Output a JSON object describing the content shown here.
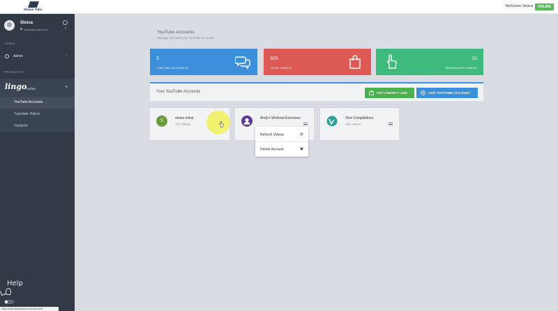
{
  "topbar": {
    "logo_text": "Shawn Tube",
    "welcome": "Welcome,Stoica",
    "status": "ONLINE"
  },
  "sidebar": {
    "profile": {
      "name": "Stoica",
      "email": "stoica@codeone.ro"
    },
    "section_admin": "ADMIN",
    "admin_item": "Admin",
    "section_products": "PRODUCTS",
    "product": {
      "logo": "lingo",
      "suffix": "Tracker"
    },
    "subnav": [
      {
        "label": "YouTube Accounts",
        "active": true
      },
      {
        "label": "Translate Videos",
        "active": false
      },
      {
        "label": "Vanitylist",
        "active": false
      }
    ],
    "help": "Help",
    "status_url": "https://www.lingotracker.com/account#"
  },
  "main": {
    "title": "YouTube Accounts",
    "subtitle": "Manage and add your YouTube accounts",
    "stats": [
      {
        "value": "3",
        "label": "YOUTUBE ACCOUNTS",
        "color": "#3b8fdb",
        "icon": "chat-bubbles-icon"
      },
      {
        "value": "305",
        "label": "TOTAL VIDEOS",
        "color": "#dd5a54",
        "icon": "shopping-bag-icon"
      },
      {
        "value": "10",
        "label": "TRANSLATED VIDEOS",
        "color": "#3dba7c",
        "icon": "pointer-hand-icon"
      }
    ],
    "toolbar": {
      "title": "Your YouTube Accounts",
      "agency_button": "GET AGENCY LINK",
      "add_button": "ADD YOUTUBE ACCOUNT"
    },
    "accounts": [
      {
        "name": "stoica mihai",
        "videos": "137 Videos",
        "avatar_letter": "S",
        "avatar_color": "#6a9a3c"
      },
      {
        "name": "Andy's Workout Exercises",
        "videos": "",
        "avatar_letter": "",
        "avatar_color": "#5b3a9e"
      },
      {
        "name": "Vine Compilations",
        "videos": "133 Videos",
        "avatar_letter": "",
        "avatar_color": "#2aa198"
      }
    ],
    "dropdown": [
      {
        "label": "Refresh Videos",
        "icon": "refresh-icon"
      },
      {
        "label": "Delete Account",
        "icon": "close-icon"
      }
    ]
  }
}
